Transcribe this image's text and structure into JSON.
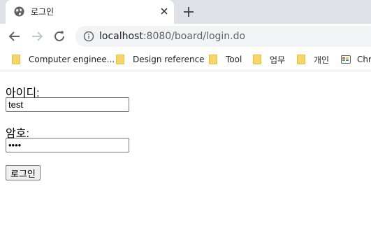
{
  "browser": {
    "tab_title": "로그인",
    "url_host": "localhost",
    "url_rest": ":8080/board/login.do",
    "bookmarks": [
      {
        "label": "Computer enginee...",
        "icon": "folder-icon"
      },
      {
        "label": "Design reference",
        "icon": "folder-icon"
      },
      {
        "label": "Tool",
        "icon": "folder-icon"
      },
      {
        "label": "업무",
        "icon": "folder-icon"
      },
      {
        "label": "개인",
        "icon": "folder-icon"
      },
      {
        "label": "Chr",
        "icon": "apps-icon"
      }
    ]
  },
  "form": {
    "id_label": "아이디:",
    "id_value": "test",
    "pw_label": "암호:",
    "pw_value": "test",
    "submit_label": "로그인"
  },
  "colors": {
    "tabstrip": "#dee1e6",
    "omnibox": "#f1f3f4",
    "folder": "#f6d66b"
  }
}
